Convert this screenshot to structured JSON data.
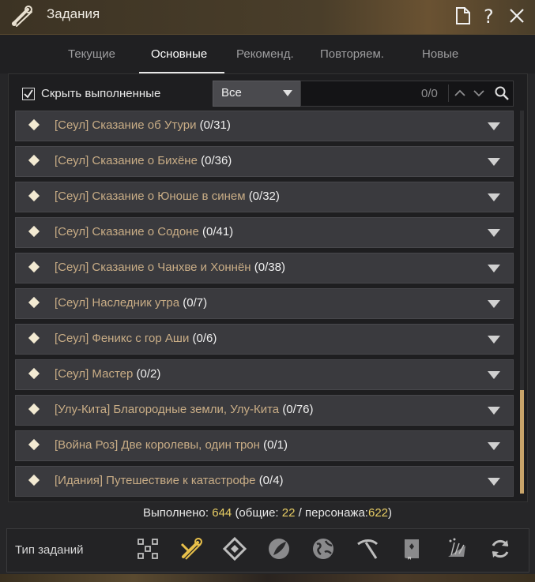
{
  "window": {
    "title": "Задания",
    "title_icon": "scroll-icon",
    "buttons": [
      "document-icon",
      "help-icon",
      "close-icon"
    ],
    "help_glyph": "?"
  },
  "tabs": [
    {
      "label": "Текущие",
      "active": false
    },
    {
      "label": "Основные",
      "active": true
    },
    {
      "label": "Рекоменд.",
      "active": false
    },
    {
      "label": "Повторяем.",
      "active": false
    },
    {
      "label": "Новые",
      "active": false
    }
  ],
  "filters": {
    "hide_completed_label": "Скрыть выполненные",
    "hide_completed_checked": true,
    "category_selected": "Все",
    "search_value": "",
    "search_count": "0/0"
  },
  "quests": [
    {
      "name": "[Сеул] Сказание об Утури",
      "count": "(0/31)"
    },
    {
      "name": "[Сеул] Сказание о Бихёне",
      "count": "(0/36)"
    },
    {
      "name": "[Сеул] Сказание о Юноше в синем",
      "count": "(0/32)"
    },
    {
      "name": "[Сеул] Сказание о Содоне",
      "count": "(0/41)"
    },
    {
      "name": "[Сеул] Сказание о Чанхве и Хоннён",
      "count": "(0/38)"
    },
    {
      "name": "[Сеул] Наследник утра",
      "count": "(0/7)"
    },
    {
      "name": "[Сеул] Феникс с гор Аши",
      "count": "(0/6)"
    },
    {
      "name": "[Сеул] Мастер",
      "count": "(0/2)"
    },
    {
      "name": "[Улу-Кита] Благородные земли, Улу-Кита",
      "count": "(0/76)"
    },
    {
      "name": "[Война Роз] Две королевы, один трон",
      "count": "(0/1)"
    },
    {
      "name": "[Идания] Путешествие к катастрофе",
      "count": "(0/4)"
    }
  ],
  "summary": {
    "completed_label": "Выполнено:",
    "completed": "644",
    "common_label": "(общие:",
    "common": "22",
    "separator": "/",
    "character_label": "персонажа:",
    "character": "622",
    "close_paren": ")"
  },
  "quest_types": {
    "label": "Тип заданий",
    "icons": [
      "all-types-icon",
      "scroll-type-icon",
      "diamond-type-icon",
      "feather-type-icon",
      "globe-type-icon",
      "pickaxe-type-icon",
      "book-type-icon",
      "fan-type-icon",
      "refresh-type-icon"
    ],
    "active_index": 1
  },
  "colors": {
    "quest_name": "#c9ad86",
    "accent_gold": "#e8cd64",
    "scroll_thumb": "#c8a46a"
  }
}
